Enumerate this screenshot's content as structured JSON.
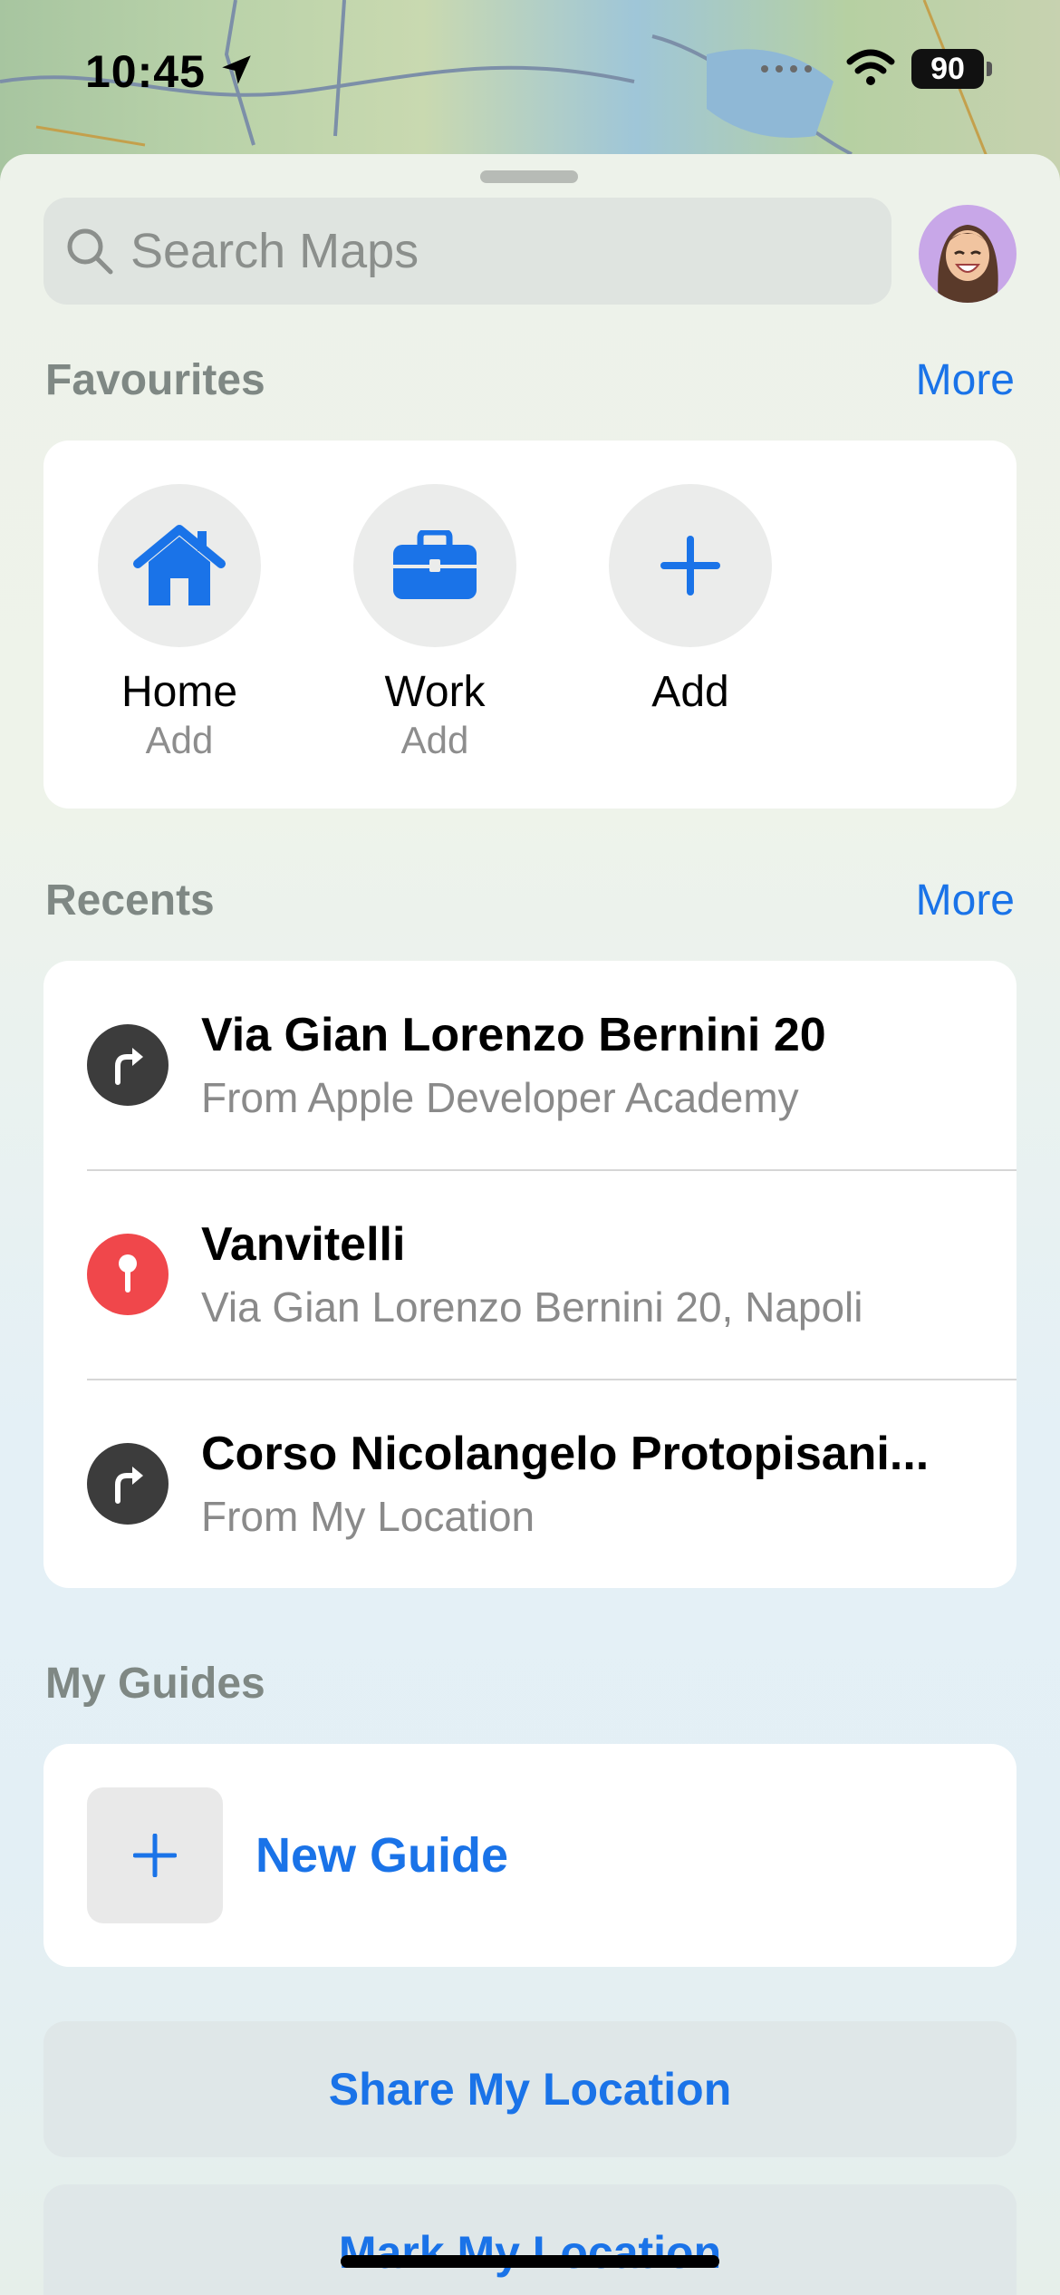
{
  "status": {
    "time": "10:45",
    "battery": "90"
  },
  "search": {
    "placeholder": "Search Maps"
  },
  "favourites": {
    "title": "Favourites",
    "more": "More",
    "items": [
      {
        "label": "Home",
        "sub": "Add",
        "icon": "house-icon"
      },
      {
        "label": "Work",
        "sub": "Add",
        "icon": "briefcase-icon"
      },
      {
        "label": "Add",
        "sub": "",
        "icon": "plus-icon"
      }
    ]
  },
  "recents": {
    "title": "Recents",
    "more": "More",
    "items": [
      {
        "title": "Via Gian Lorenzo Bernini 20",
        "sub": "From Apple Developer Academy",
        "icon": "directions-turn-icon",
        "color": "#3c3c3c"
      },
      {
        "title": "Vanvitelli",
        "sub": "Via Gian Lorenzo Bernini 20, Napoli",
        "icon": "pin-icon",
        "color": "#f0474b"
      },
      {
        "title": "Corso Nicolangelo Protopisani...",
        "sub": "From My Location",
        "icon": "directions-turn-icon",
        "color": "#3c3c3c"
      }
    ]
  },
  "guides": {
    "title": "My Guides",
    "new_guide": "New Guide"
  },
  "actions": {
    "share": "Share My Location",
    "mark": "Mark My Location"
  },
  "colors": {
    "accent": "#1a73e8"
  }
}
